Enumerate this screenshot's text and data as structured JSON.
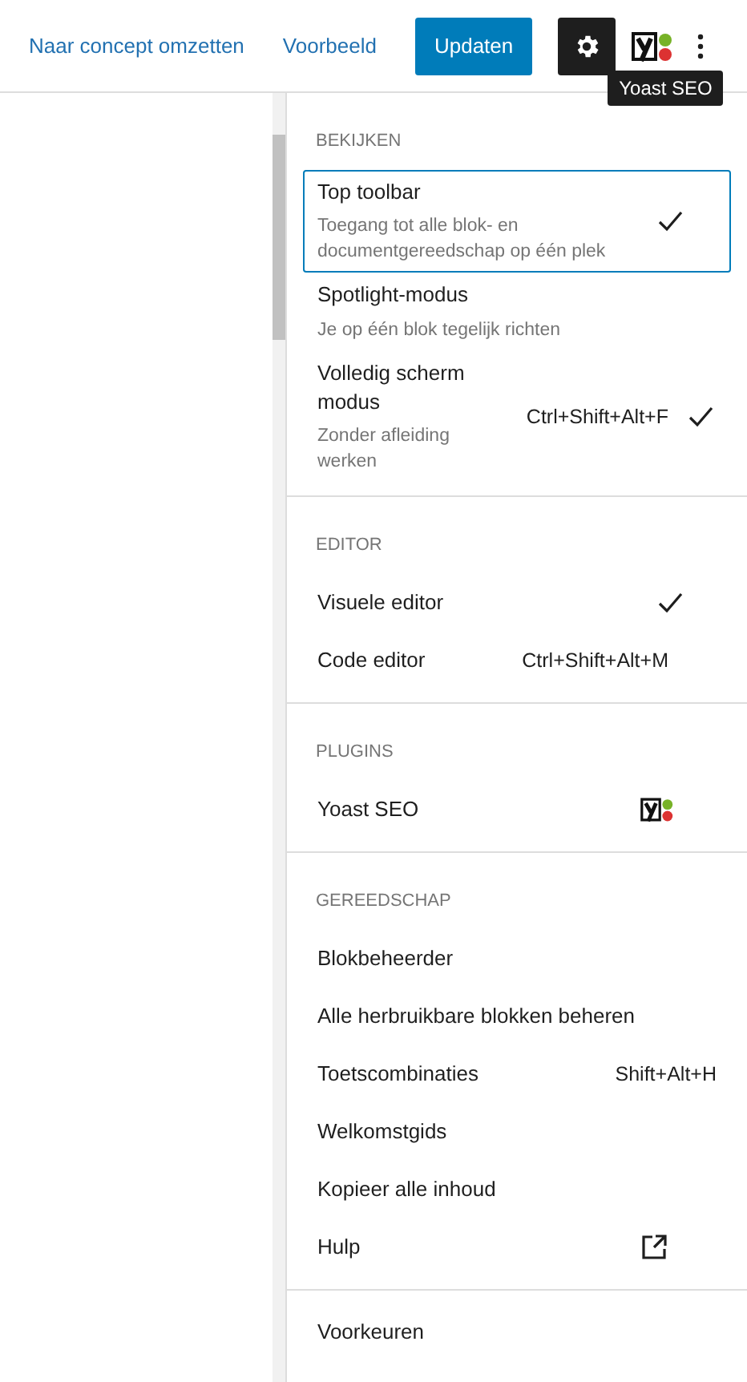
{
  "header": {
    "links": [
      "Naar concept omzetten",
      "Voorbeeld"
    ],
    "primary_button": "Updaten",
    "settings_selected": true,
    "tooltip": "Yoast SEO"
  },
  "menu": {
    "sections": [
      {
        "title": "BEKIJKEN",
        "items": [
          {
            "kind": "check",
            "label": "Top toolbar",
            "description": "Toegang tot alle blok- en documentgereedschap op één plek",
            "checked": true,
            "focused": true
          },
          {
            "kind": "check",
            "label": "Spotlight-modus",
            "description": "Je op één blok tegelijk richten",
            "checked": false,
            "focused": false
          },
          {
            "kind": "check",
            "label": "Volledig scherm modus",
            "description": "Zonder afleiding werken",
            "shortcut": "Ctrl+Shift+Alt+F",
            "checked": true,
            "focused": false
          }
        ]
      },
      {
        "title": "EDITOR",
        "items": [
          {
            "kind": "check",
            "label": "Visuele editor",
            "checked": true,
            "focused": false
          },
          {
            "kind": "check",
            "label": "Code editor",
            "shortcut": "Ctrl+Shift+Alt+M",
            "checked": false,
            "focused": false
          }
        ]
      },
      {
        "title": "PLUGINS",
        "items": [
          {
            "kind": "yoast",
            "label": "Yoast SEO"
          }
        ]
      },
      {
        "title": "GEREEDSCHAP",
        "items": [
          {
            "kind": "plain",
            "label": "Blokbeheerder"
          },
          {
            "kind": "plain",
            "label": "Alle herbruikbare blokken beheren"
          },
          {
            "kind": "plain",
            "label": "Toetscombinaties",
            "shortcut": "Shift+Alt+H"
          },
          {
            "kind": "plain",
            "label": "Welkomstgids"
          },
          {
            "kind": "plain",
            "label": "Kopieer alle inhoud"
          },
          {
            "kind": "external",
            "label": "Hulp"
          }
        ]
      },
      {
        "items": [
          {
            "kind": "plain",
            "label": "Voorkeuren"
          }
        ]
      }
    ]
  }
}
